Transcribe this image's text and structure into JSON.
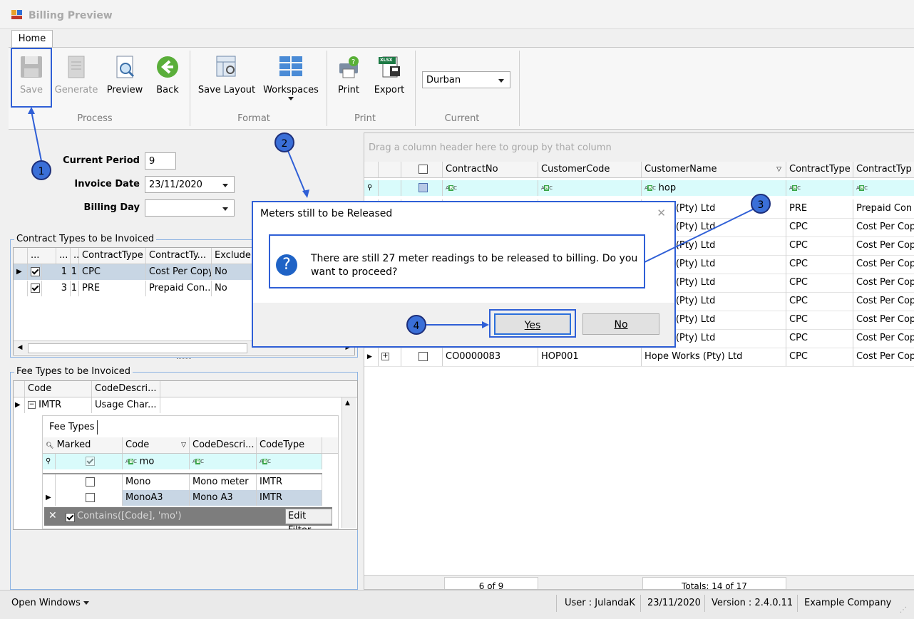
{
  "window": {
    "title": "Billing Preview"
  },
  "ribbon": {
    "tab": "Home",
    "buttons": {
      "save": "Save",
      "generate": "Generate",
      "preview": "Preview",
      "back": "Back",
      "save_layout": "Save Layout",
      "workspaces": "Workspaces",
      "print": "Print",
      "export": "Export"
    },
    "groups": {
      "process": "Process",
      "format": "Format",
      "print": "Print",
      "current": "Current"
    },
    "current_branch": "Durban",
    "export_badge": "XLSX"
  },
  "params": {
    "current_period_label": "Current Period",
    "current_period": "9",
    "invoice_date_label": "Invoice Date",
    "invoice_date": "23/11/2020",
    "billing_day_label": "Billing Day",
    "billing_day": ""
  },
  "contract_types": {
    "title": "Contract Types to be Invoiced",
    "headers": [
      "...",
      "...",
      "...",
      "ContractType",
      "ContractTy...",
      "ExcludeF"
    ],
    "rows": [
      {
        "c1": "1",
        "c2": "1",
        "type": "CPC",
        "desc": "Cost Per Copy",
        "exclude": "No",
        "checked": true
      },
      {
        "c1": "3",
        "c2": "1",
        "type": "PRE",
        "desc": "Prepaid Con...",
        "exclude": "No",
        "checked": true
      }
    ]
  },
  "fee_types": {
    "title": "Fee Types to be Invoiced",
    "headers": [
      "Code",
      "CodeDescri..."
    ],
    "row": {
      "code": "IMTR",
      "desc": "Usage Char..."
    },
    "detail": {
      "tab": "Fee Types",
      "headers": [
        "Marked",
        "Code",
        "CodeDescri...",
        "CodeType"
      ],
      "filter_code": "mo",
      "rows": [
        {
          "code": "Mono",
          "desc": "Mono meter",
          "type": "IMTR"
        },
        {
          "code": "MonoA3",
          "desc": "Mono A3",
          "type": "IMTR"
        }
      ],
      "filter_text": "Contains([Code], 'mo')",
      "edit_filter": "Edit Filter"
    }
  },
  "main_grid": {
    "group_hint": "Drag a column header here to group by that column",
    "headers": [
      "ContractNo",
      "CustomerCode",
      "CustomerName",
      "ContractType",
      "ContractTyp"
    ],
    "filter_customer": "hop",
    "rows": [
      {
        "no": "",
        "code": "",
        "name": "Works (Pty) Ltd",
        "type": "PRE",
        "desc": "Prepaid Con"
      },
      {
        "no": "",
        "code": "",
        "name": "Works (Pty) Ltd",
        "type": "CPC",
        "desc": "Cost Per Cop"
      },
      {
        "no": "",
        "code": "",
        "name": "Works (Pty) Ltd",
        "type": "CPC",
        "desc": "Cost Per Cop"
      },
      {
        "no": "",
        "code": "",
        "name": "Works (Pty) Ltd",
        "type": "CPC",
        "desc": "Cost Per Cop"
      },
      {
        "no": "",
        "code": "",
        "name": "Works (Pty) Ltd",
        "type": "CPC",
        "desc": "Cost Per Cop"
      },
      {
        "no": "",
        "code": "",
        "name": "Works (Pty) Ltd",
        "type": "CPC",
        "desc": "Cost Per Cop"
      },
      {
        "no": "",
        "code": "",
        "name": "Works (Pty) Ltd",
        "type": "CPC",
        "desc": "Cost Per Cop"
      },
      {
        "no": "",
        "code": "",
        "name": "Works (Pty) Ltd",
        "type": "CPC",
        "desc": "Cost Per Cop"
      },
      {
        "no": "CO0000083",
        "code": "HOP001",
        "name": "Hope Works (Pty) Ltd",
        "type": "CPC",
        "desc": "Cost Per Cop"
      }
    ],
    "footer_count": "6 of 9",
    "footer_totals": "Totals: 14 of 17"
  },
  "dialog": {
    "title": "Meters still to be Released",
    "message": "There are still 27 meter readings to be released to billing.  Do you want to proceed?",
    "yes": "Yes",
    "no": "No"
  },
  "annotations": [
    "1",
    "2",
    "3",
    "4"
  ],
  "status": {
    "open_windows": "Open Windows",
    "user": "User : JulandaK",
    "date": "23/11/2020",
    "version": "Version : 2.4.0.11",
    "company": "Example Company"
  },
  "colors": {
    "annotation": "#3a6fd8",
    "dialog_border": "#2f5fd6",
    "filter_row": "#d9fbfb",
    "selected_row": "#c8d6e4"
  }
}
